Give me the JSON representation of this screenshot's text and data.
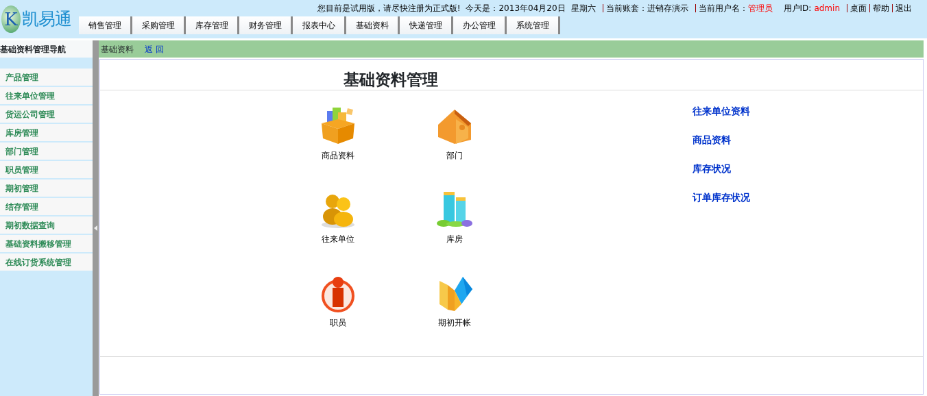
{
  "header": {
    "logo_letter": "K",
    "logo_text": "凯易通",
    "notice": "您目前是试用版，请尽快注册为正式版!",
    "date_label": "今天是：",
    "date": "2013年04月20日",
    "weekday": "星期六",
    "account_label": "当前账套：",
    "account": "进销存演示",
    "user_label": "当前用户名：",
    "user": "管理员",
    "user_id_label": "用户ID:",
    "user_id": "admin",
    "links": [
      "桌面",
      "帮助",
      "退出"
    ]
  },
  "tabs": [
    "销售管理",
    "采购管理",
    "库存管理",
    "财务管理",
    "报表中心",
    "基础资料",
    "快递管理",
    "办公管理",
    "系统管理"
  ],
  "sidebar": {
    "title": "基础资料管理导航",
    "items": [
      "产品管理",
      "往来单位管理",
      "货运公司管理",
      "库房管理",
      "部门管理",
      "职员管理",
      "期初管理",
      "结存管理",
      "期初数据查询",
      "基础资料搬移管理",
      "在线订货系统管理"
    ]
  },
  "breadcrumb": {
    "current": "基础资料",
    "back": "返 回"
  },
  "page_title": "基础资料管理",
  "modules": [
    {
      "kind": "box",
      "label": "商品资料"
    },
    {
      "kind": "house",
      "label": "部门"
    },
    {
      "kind": "people",
      "label": "往来单位"
    },
    {
      "kind": "buildings",
      "label": "库房"
    },
    {
      "kind": "person",
      "label": "职员"
    },
    {
      "kind": "folder",
      "label": "期初开帐"
    }
  ],
  "quick_links": [
    "往来单位资料",
    "商品资料",
    "库存状况",
    "订单库存状况"
  ]
}
